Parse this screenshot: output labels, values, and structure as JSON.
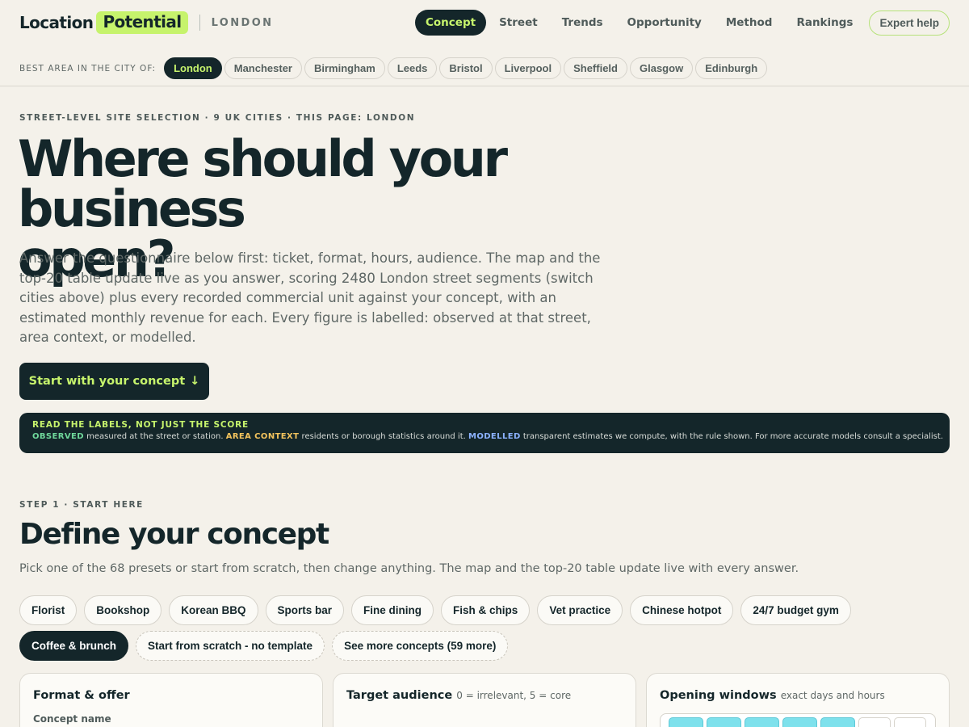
{
  "brand": {
    "word": "Location",
    "badge": "Potential",
    "city": "LONDON"
  },
  "nav": {
    "items": [
      "Concept",
      "Street",
      "Trends",
      "Opportunity",
      "Method",
      "Rankings"
    ],
    "active_index": 0,
    "cta": "Expert help"
  },
  "citybar": {
    "label": "BEST AREA IN THE CITY OF:",
    "cities": [
      "London",
      "Manchester",
      "Birmingham",
      "Leeds",
      "Bristol",
      "Liverpool",
      "Sheffield",
      "Glasgow",
      "Edinburgh"
    ],
    "active_index": 0
  },
  "hero": {
    "eyebrow": "STREET-LEVEL SITE SELECTION · 9 UK CITIES · THIS PAGE: LONDON",
    "title_line1": "Where should your business",
    "title_line2": "open?",
    "body": "Answer the questionnaire below first: ticket, format, hours, audience. The map and the top-20 table update live as you answer, scoring 2480 London street segments (switch cities above) plus every recorded commercial unit against your concept, with an estimated monthly revenue for each. Every figure is labelled: observed at that street, area context, or modelled.",
    "start_button": "Start with your concept",
    "start_arrow": "↓"
  },
  "legend": {
    "heading": "READ THE LABELS, NOT JUST THE SCORE",
    "observed_tag": "OBSERVED",
    "observed_text": " measured at the street or station. ",
    "area_tag": "AREA CONTEXT",
    "area_text": " residents or borough statistics around it. ",
    "modelled_tag": "MODELLED",
    "modelled_text": " transparent estimates we compute, with the rule shown. For more accurate models consult a specialist."
  },
  "step1": {
    "eyebrow": "STEP 1 · START HERE",
    "title": "Define your concept",
    "subtitle": "Pick one of the 68 presets or start from scratch, then change anything. The map and the top-20 table update live with every answer.",
    "presets_row1": [
      "Florist",
      "Bookshop",
      "Korean BBQ",
      "Sports bar",
      "Fine dining",
      "Fish & chips",
      "Vet practice",
      "Chinese hotpot",
      "24/7 budget gym"
    ],
    "presets_row2_active": "Coffee & brunch",
    "scratch": "Start from scratch - no template",
    "more": "See more concepts (59 more)"
  },
  "cards": {
    "format_title": "Format & offer",
    "concept_name_label": "Concept name",
    "audience_title": "Target audience",
    "audience_hint": "0 = irrelevant, 5 = core",
    "hours_title": "Opening windows",
    "hours_hint": "exact days and hours",
    "hours_active_cells": 5,
    "hours_total_cells": 7
  },
  "colors": {
    "background": "#f4f1ea",
    "ink": "#14262a",
    "accent": "#c6f36c",
    "observed": "#6fd79b",
    "area_context": "#f3c35d",
    "modelled": "#8cb2ff"
  }
}
